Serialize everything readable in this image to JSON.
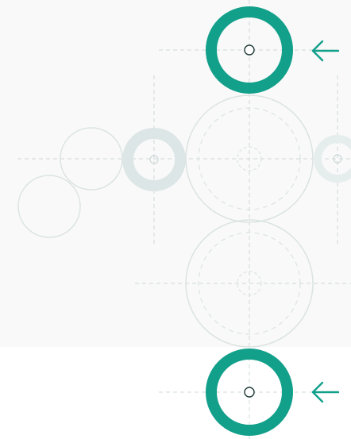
{
  "colors": {
    "background": "#ffffff",
    "panel": "#f9f9f9",
    "accent": "#12a08a",
    "accent_faint": "#dde6e6",
    "outline": "#dbe4e2",
    "guide": "#cfd8d8",
    "hub": "#1f3b38"
  },
  "icons": {
    "top_arrow": "arrow-left-icon",
    "bottom_arrow": "arrow-left-icon"
  }
}
